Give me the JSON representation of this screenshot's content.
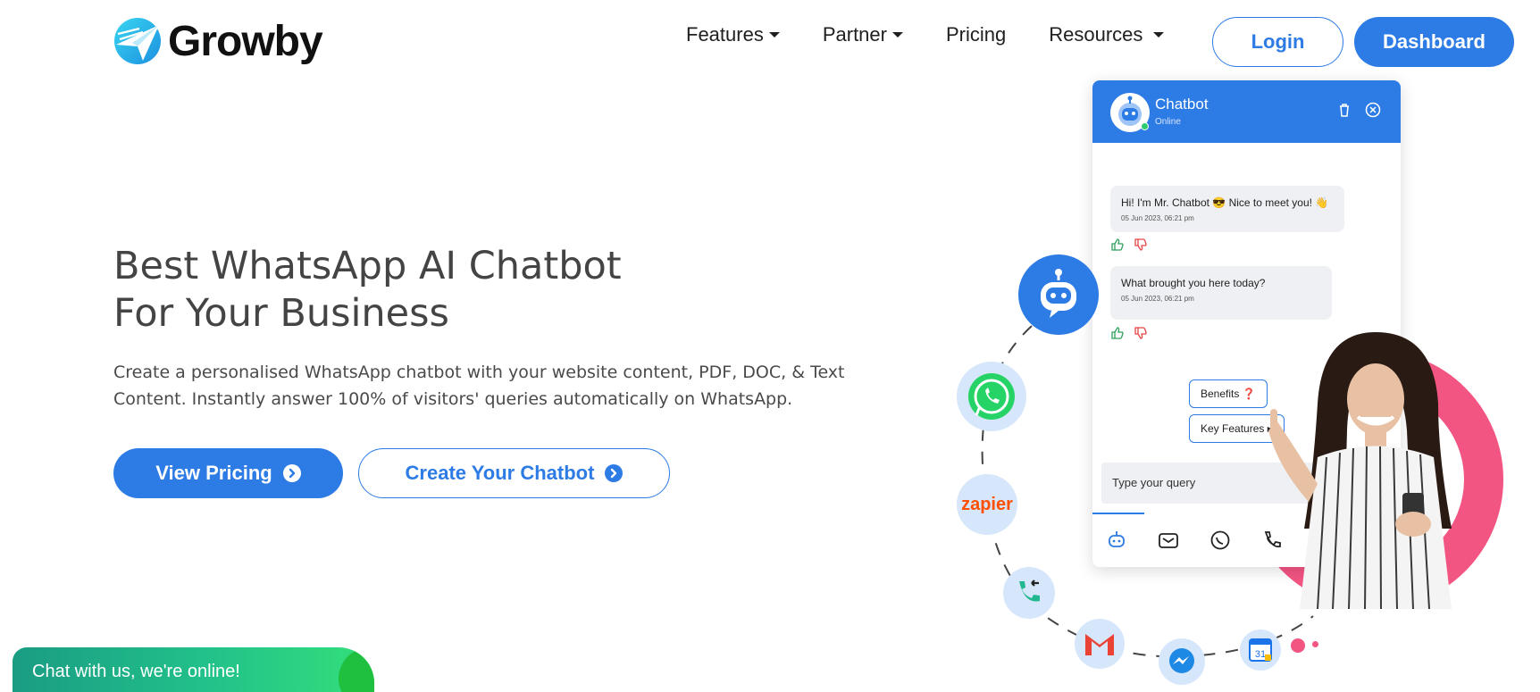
{
  "brand": {
    "name": "Growby",
    "accent": "#2d7be5",
    "pink": "#f35583"
  },
  "nav": {
    "items": [
      {
        "label": "Features",
        "dropdown": true
      },
      {
        "label": "Partner",
        "dropdown": true
      },
      {
        "label": "Pricing",
        "dropdown": false
      },
      {
        "label": "Resources",
        "dropdown": true
      }
    ],
    "login_label": "Login",
    "dashboard_label": "Dashboard"
  },
  "hero": {
    "title_line1": "Best WhatsApp AI Chatbot",
    "title_line2": "For Your Business",
    "subtitle_line1": "Create a personalised WhatsApp chatbot with your website content, PDF, DOC, & Text",
    "subtitle_line2": "Content. Instantly answer 100% of visitors' queries automatically on WhatsApp.",
    "primary_cta": "View Pricing",
    "secondary_cta": "Create Your Chatbot"
  },
  "chat_widget": {
    "label": "Chat with us, we're online!"
  },
  "illustration": {
    "chat_title": "Chatbot",
    "chat_status": "Online",
    "messages": [
      {
        "text": "Hi! I'm Mr. Chatbot 😎 Nice to meet you! 👋",
        "time": "05 Jun 2023, 06:21 pm"
      },
      {
        "text": "What brought you here today?",
        "time": "05 Jun 2023, 06:21 pm"
      }
    ],
    "quick_replies": [
      "Benefits ❓",
      "Key Features ▸"
    ],
    "input_placeholder": "Type your query",
    "zapier_label": "zapier",
    "calendar_day": "31",
    "icons": [
      "robot-icon",
      "whatsapp-icon",
      "zapier-icon",
      "phone-callback-icon",
      "gmail-icon",
      "messenger-icon",
      "google-calendar-icon"
    ]
  }
}
